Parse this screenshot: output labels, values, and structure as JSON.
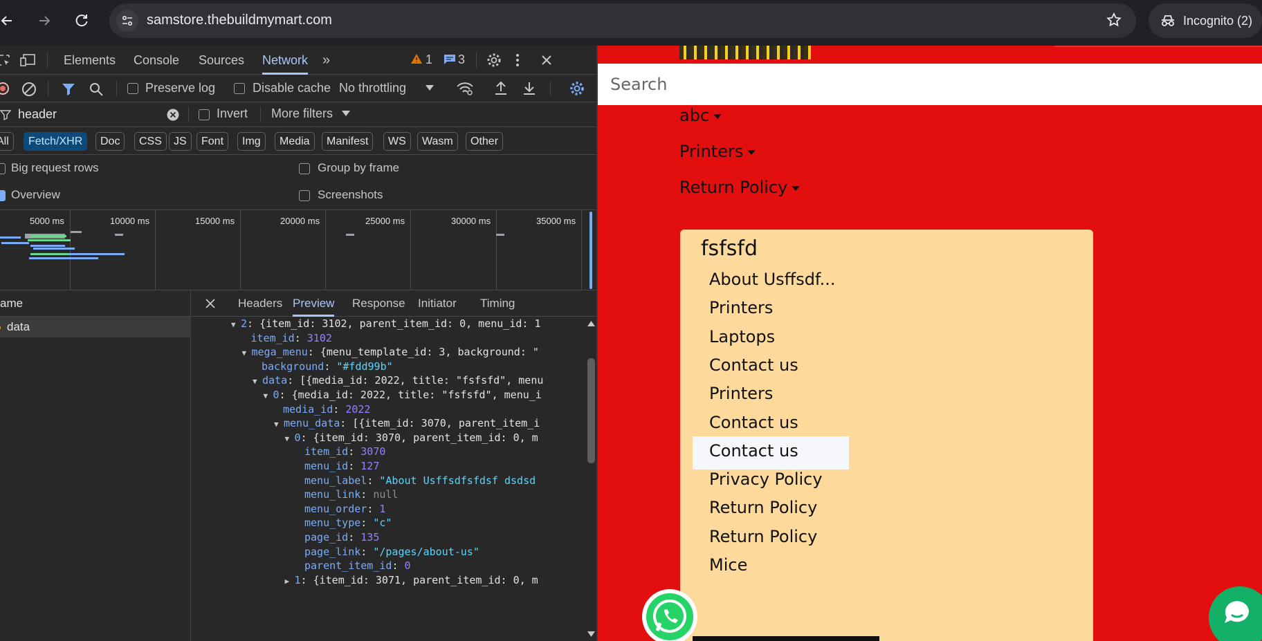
{
  "browser": {
    "url": "samstore.thebuildmymart.com",
    "incognito_label": "Incognito (2)"
  },
  "devtools": {
    "tabs": [
      "Elements",
      "Console",
      "Sources",
      "Network"
    ],
    "active_tab": "Network",
    "warnings_count": "1",
    "messages_count": "3",
    "toolbar": {
      "preserve_log": "Preserve log",
      "disable_cache": "Disable cache",
      "throttling": "No throttling"
    },
    "filter": {
      "value": "header",
      "invert_label": "Invert",
      "more_filters": "More filters"
    },
    "type_filters": [
      "All",
      "Fetch/XHR",
      "Doc",
      "CSS",
      "JS",
      "Font",
      "Img",
      "Media",
      "Manifest",
      "WS",
      "Wasm",
      "Other"
    ],
    "active_type_filter": "Fetch/XHR",
    "options": {
      "big_request_rows": "Big request rows",
      "group_by_frame": "Group by frame",
      "overview": "Overview",
      "screenshots": "Screenshots"
    },
    "timeline_ticks": [
      "5000 ms",
      "10000 ms",
      "15000 ms",
      "20000 ms",
      "25000 ms",
      "30000 ms",
      "35000 ms"
    ],
    "name_column_header": "ame",
    "requests": [
      "data"
    ],
    "detail_tabs": [
      "Headers",
      "Preview",
      "Response",
      "Initiator",
      "Timing"
    ],
    "active_detail_tab": "Preview",
    "preview_lines": [
      {
        "indent": 0,
        "tri": "▼",
        "key": "2",
        "text": "{item_id: 3102, parent_item_id: 0, menu_id: 1"
      },
      {
        "indent": 1,
        "key": "item_id",
        "num": "3102"
      },
      {
        "indent": 1,
        "tri": "▼",
        "key": "mega_menu",
        "text": "{menu_template_id: 3, background: \""
      },
      {
        "indent": 2,
        "key": "background",
        "str": "\"#fdd99b\""
      },
      {
        "indent": 2,
        "tri": "▼",
        "key": "data",
        "text": "[{media_id: 2022, title: \"fsfsfd\", menu"
      },
      {
        "indent": 3,
        "tri": "▼",
        "key": "0",
        "text": "{media_id: 2022, title: \"fsfsfd\", menu_i"
      },
      {
        "indent": 4,
        "key": "media_id",
        "num": "2022"
      },
      {
        "indent": 4,
        "tri": "▼",
        "key": "menu_data",
        "text": "[{item_id: 3070, parent_item_i"
      },
      {
        "indent": 5,
        "tri": "▼",
        "key": "0",
        "text": "{item_id: 3070, parent_item_id: 0, m"
      },
      {
        "indent": 6,
        "key": "item_id",
        "num": "3070"
      },
      {
        "indent": 6,
        "key": "menu_id",
        "num": "127"
      },
      {
        "indent": 6,
        "key": "menu_label",
        "str": "\"About Usffsdfsfdsf dsdsd"
      },
      {
        "indent": 6,
        "key": "menu_link",
        "nul": "null"
      },
      {
        "indent": 6,
        "key": "menu_order",
        "num": "1"
      },
      {
        "indent": 6,
        "key": "menu_type",
        "str": "\"c\""
      },
      {
        "indent": 6,
        "key": "page_id",
        "num": "135"
      },
      {
        "indent": 6,
        "key": "page_link",
        "str": "\"/pages/about-us\""
      },
      {
        "indent": 6,
        "key": "parent_item_id",
        "num": "0"
      },
      {
        "indent": 5,
        "tri": "▶",
        "key": "1",
        "text": "{item_id: 3071, parent_item_id: 0, m"
      }
    ]
  },
  "site": {
    "search_placeholder": "Search",
    "nav": [
      "abc",
      "Printers",
      "Return Policy"
    ],
    "mega_menu": {
      "background": "#fdd99b",
      "title": "fsfsfd",
      "items": [
        "About Usffsdf...",
        "Printers",
        "Laptops",
        "Contact us",
        "Printers",
        "Contact us",
        "Contact us",
        "Privacy Policy",
        "Return Policy",
        "Return Policy",
        "Mice"
      ],
      "hovered_index": 5
    },
    "colors": {
      "page_background": "#e30f0f",
      "whatsapp": "#25d366",
      "chat": "#13b067"
    }
  }
}
